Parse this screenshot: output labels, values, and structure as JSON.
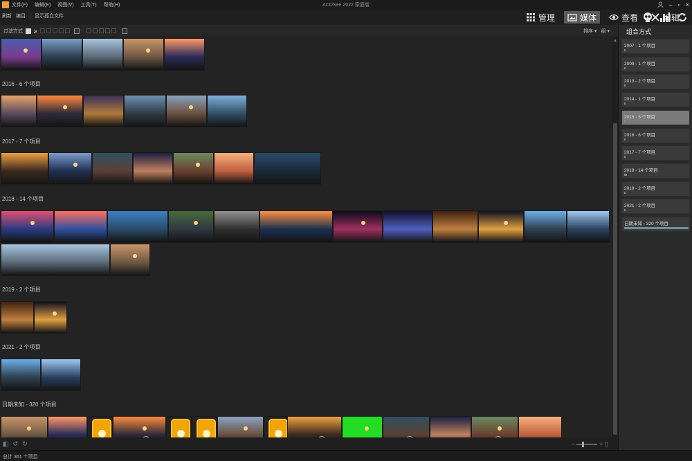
{
  "titlebar": {
    "menus": [
      "文件(F)",
      "编辑(E)",
      "视图(V)",
      "工具(T)",
      "帮助(H)"
    ],
    "window_title": "ACDSee 2022 家庭版",
    "controls": {
      "minimize": "–",
      "restore": "▫",
      "close": "×"
    }
  },
  "toolbar": {
    "left": [
      "刷新",
      "编目",
      "显示孤立文件"
    ],
    "modes": [
      {
        "label": "管理",
        "icon": "grid-icon",
        "active": false
      },
      {
        "label": "媒体",
        "icon": "media-icon",
        "active": true
      },
      {
        "label": "查看",
        "icon": "eye-icon",
        "active": false
      },
      {
        "label": "编辑",
        "icon": "edit-tools-icon",
        "active": false
      }
    ],
    "tools": [
      "skull-icon",
      "histogram-icon",
      "sync-icon"
    ]
  },
  "filterbar": {
    "label": "过滤方式",
    "ge_symbol": "≥",
    "sort": "排序 ▾",
    "group": "组 ▾"
  },
  "groups": [
    {
      "label": "",
      "thumbs": 5
    },
    {
      "label": "2016 - 6 个项目",
      "thumbs": 6
    },
    {
      "label": "2017 - 7 个项目",
      "thumbs": 7
    },
    {
      "label": "2018 - 14 个项目",
      "thumbs": 14
    },
    {
      "label": "2019 - 2 个项目",
      "thumbs": 2
    },
    {
      "label": "2021 - 2 个项目",
      "thumbs": 2
    },
    {
      "label": "日期未知 - 320 个项目",
      "thumbs": 14
    }
  ],
  "panel": {
    "title": "组合方式",
    "items": [
      {
        "label": "2007 - 1 个项目",
        "fill": 0.02,
        "active": false
      },
      {
        "label": "2009 - 1 个项目",
        "fill": 0.02,
        "active": false
      },
      {
        "label": "2013 - 2 个项目",
        "fill": 0.02,
        "active": false
      },
      {
        "label": "2014 - 1 个项目",
        "fill": 0.02,
        "active": false
      },
      {
        "label": "2015 - 5 个项目",
        "fill": 0.02,
        "active": true
      },
      {
        "label": "2016 - 6 个项目",
        "fill": 0.02,
        "active": false
      },
      {
        "label": "2017 - 7 个项目",
        "fill": 0.02,
        "active": false
      },
      {
        "label": "2018 - 14 个项目",
        "fill": 0.04,
        "active": false
      },
      {
        "label": "2019 - 2 个项目",
        "fill": 0.02,
        "active": false
      },
      {
        "label": "2021 - 2 个项目",
        "fill": 0.02,
        "active": false
      },
      {
        "label": "日期未知 - 320 个项目",
        "fill": 1.0,
        "active": false
      }
    ]
  },
  "status": {
    "text": "总计 361 个项目"
  },
  "colors": {
    "accent": "#6d8ea8",
    "active_tab": "#5a5a5a",
    "audio_icon": "#f2a400"
  }
}
